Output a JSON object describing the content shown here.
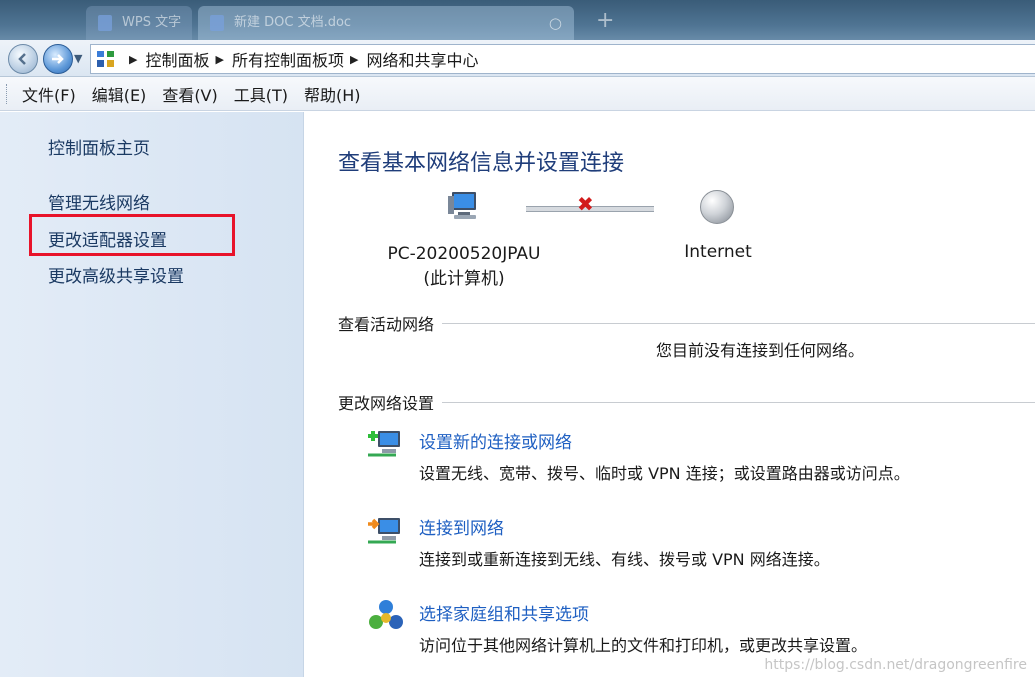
{
  "taskbar": {
    "tabs": [
      {
        "label": "WPS 文字"
      },
      {
        "label": "新建 DOC 文档.doc"
      }
    ]
  },
  "address_bar": {
    "breadcrumb": [
      "控制面板",
      "所有控制面板项",
      "网络和共享中心"
    ]
  },
  "menu": {
    "items": [
      "文件(F)",
      "编辑(E)",
      "查看(V)",
      "工具(T)",
      "帮助(H)"
    ]
  },
  "sidebar": {
    "items": [
      {
        "label": "控制面板主页"
      },
      {
        "label": "管理无线网络"
      },
      {
        "label": "更改适配器设置"
      },
      {
        "label": "更改高级共享设置"
      }
    ],
    "highlight_color": "#e8132a"
  },
  "main": {
    "title": "查看基本网络信息并设置连接",
    "map": {
      "computer_name": "PC-20200520JPAU",
      "computer_caption": "(此计算机)",
      "internet_label": "Internet",
      "status": "disconnected"
    },
    "active_networks": {
      "heading": "查看活动网络",
      "message": "您目前没有连接到任何网络。"
    },
    "change_settings": {
      "heading": "更改网络设置",
      "tasks": [
        {
          "icon": "new-connection-icon",
          "link": "设置新的连接或网络",
          "description": "设置无线、宽带、拨号、临时或 VPN 连接；或设置路由器或访问点。"
        },
        {
          "icon": "connect-network-icon",
          "link": "连接到网络",
          "description": "连接到或重新连接到无线、有线、拨号或 VPN 网络连接。"
        },
        {
          "icon": "homegroup-icon",
          "link": "选择家庭组和共享选项",
          "description": "访问位于其他网络计算机上的文件和打印机，或更改共享设置。"
        }
      ]
    }
  },
  "watermark": "https://blog.csdn.net/dragongreenfire",
  "colors": {
    "link": "#1e5fc2",
    "title": "#1f3d7a",
    "sidebar_text": "#1b3a63",
    "sidebar_bg": "#dde8f5"
  }
}
